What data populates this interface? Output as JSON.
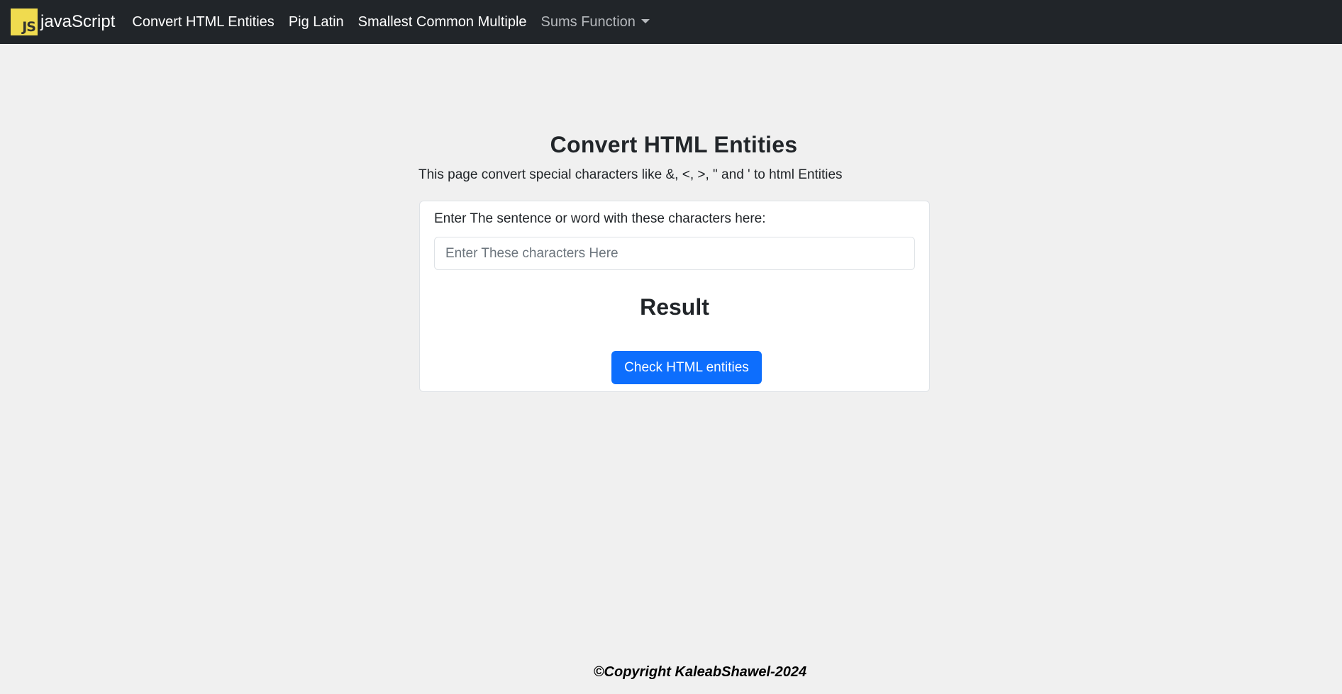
{
  "navbar": {
    "brand_logo_text": "JS",
    "brand_text": "javaScript",
    "links": [
      {
        "label": "Convert HTML Entities"
      },
      {
        "label": "Pig Latin"
      },
      {
        "label": "Smallest Common Multiple"
      },
      {
        "label": "Sums Function"
      }
    ]
  },
  "main": {
    "title": "Convert HTML Entities",
    "description": "This page convert special characters like &, <, >, \" and ' to html Entities",
    "card": {
      "input_label": "Enter The sentence or word with these characters here:",
      "input_placeholder": "Enter These characters Here",
      "input_value": "",
      "result_heading": "Result",
      "button_label": "Check HTML entities"
    }
  },
  "footer": {
    "copyright": "©Copyright KaleabShawel-2024"
  },
  "colors": {
    "navbar_bg": "#212529",
    "page_bg": "#f0f0f0",
    "primary_button": "#0d6efd",
    "js_logo": "#f0db4f"
  },
  "icons": {
    "brand": "js-logo-icon",
    "dropdown": "chevron-down-icon"
  }
}
